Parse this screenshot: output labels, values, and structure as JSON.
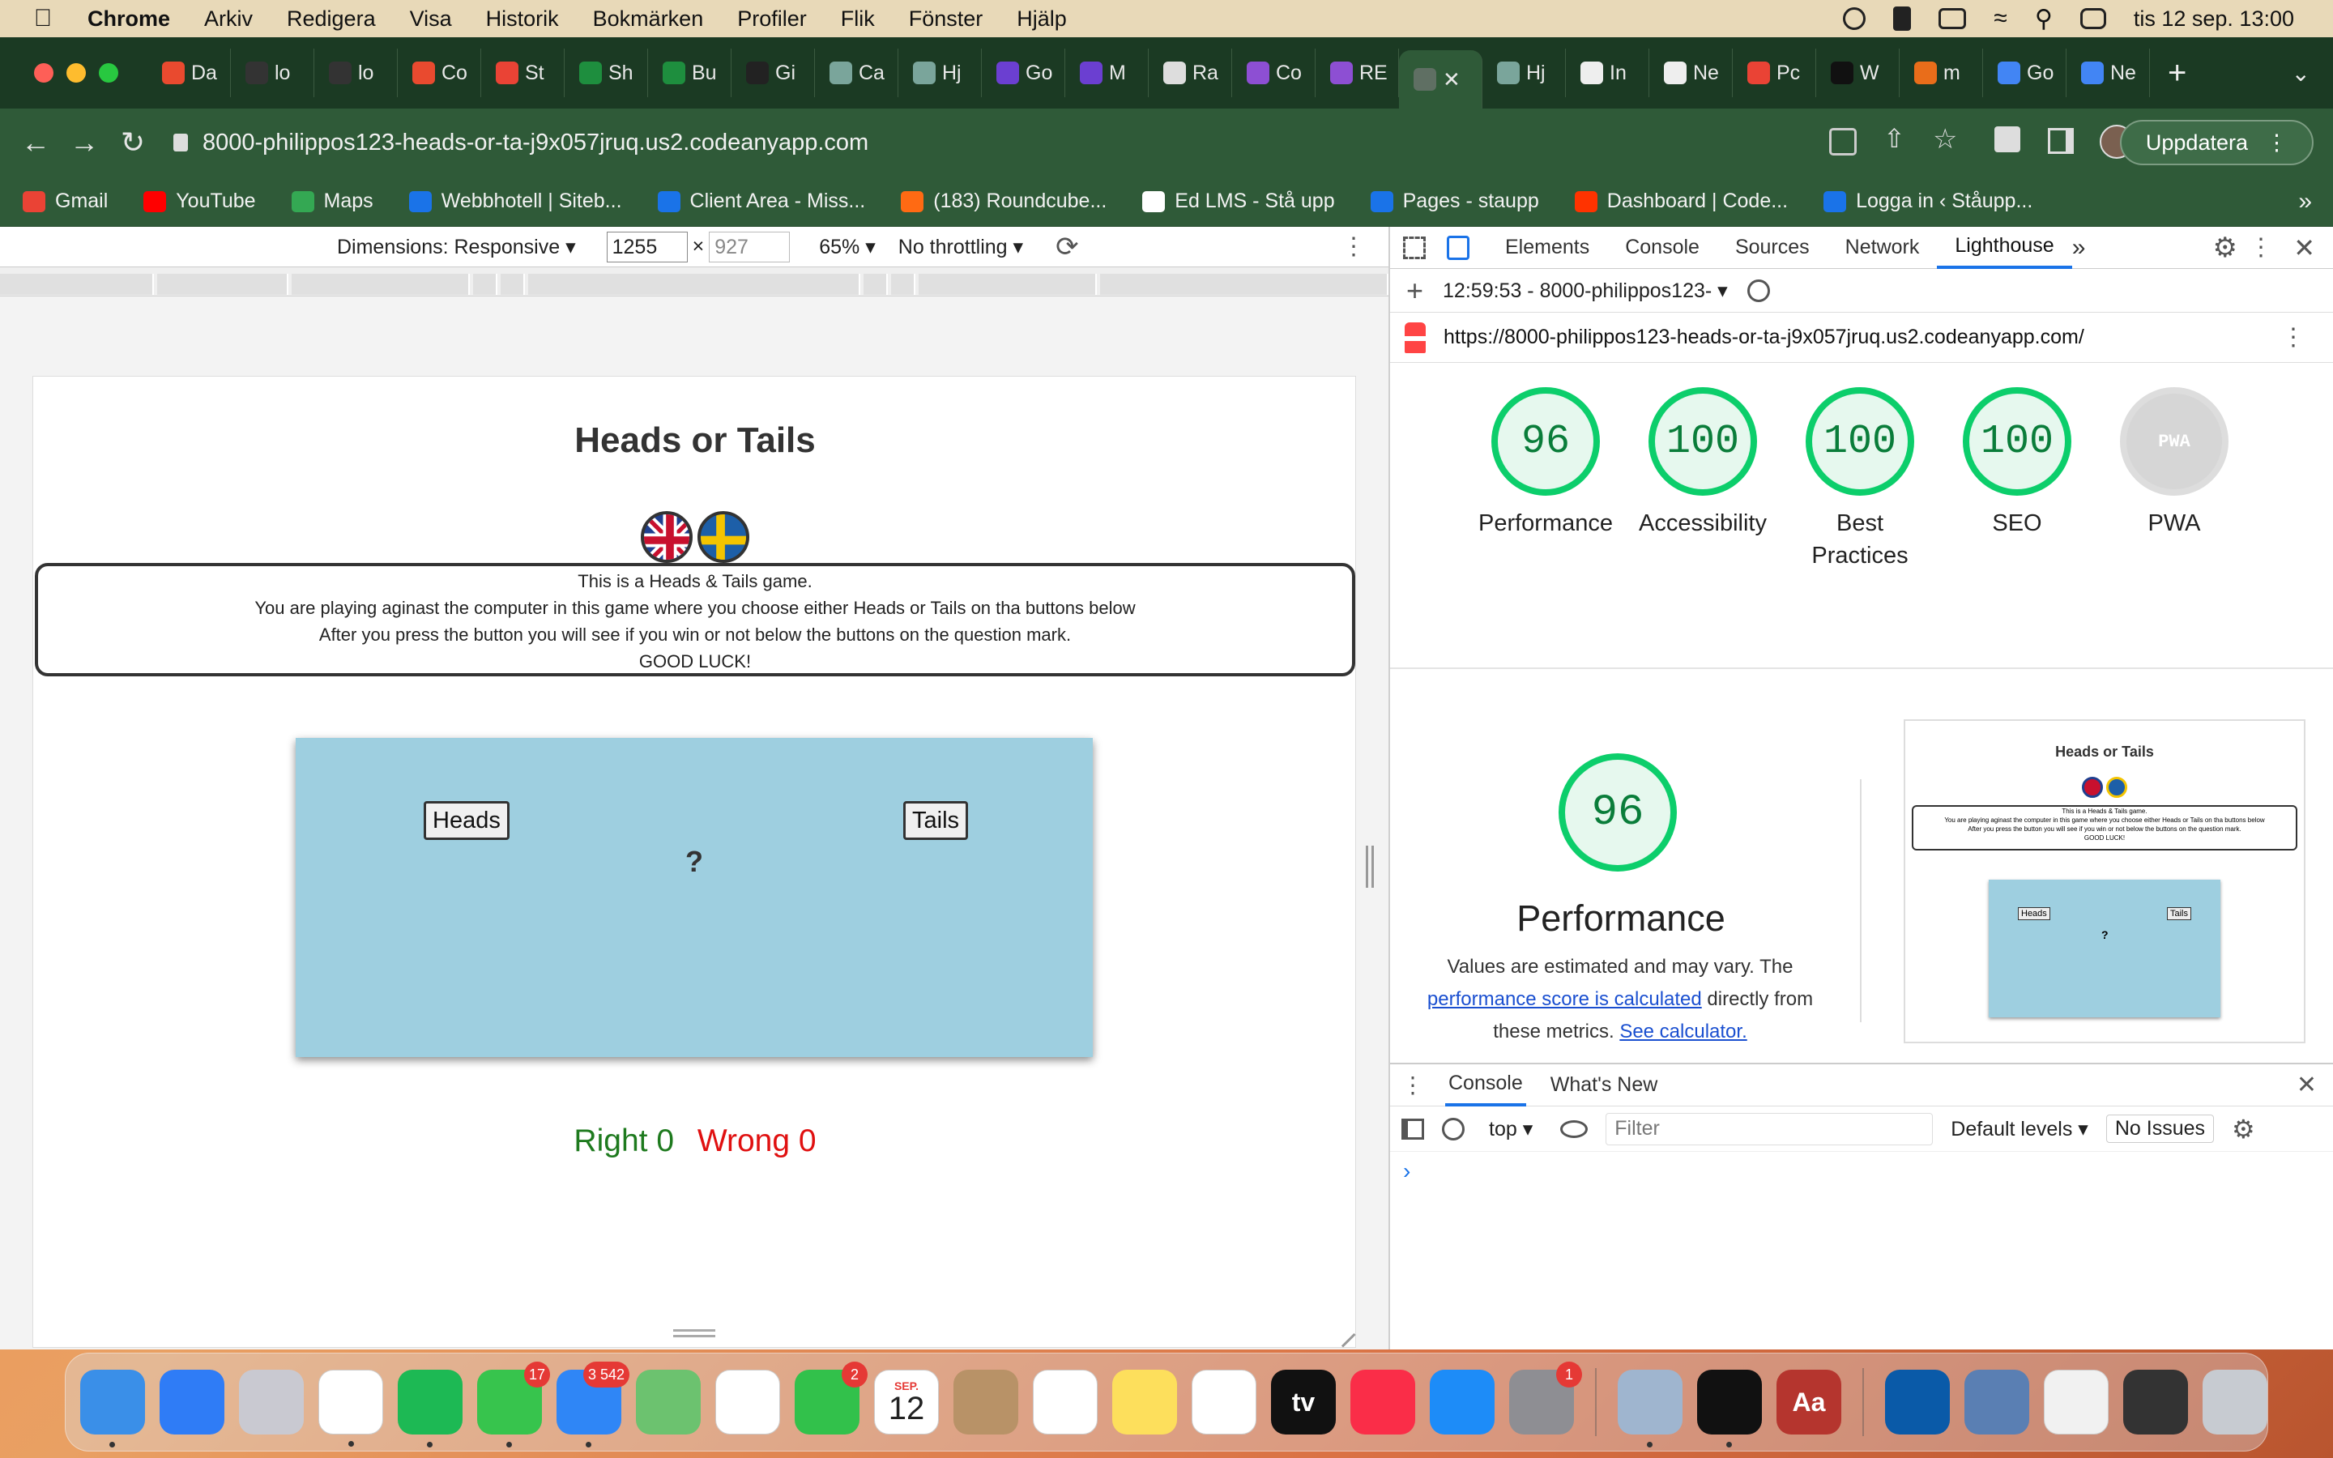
{
  "menubar": {
    "app": "Chrome",
    "items": [
      "Arkiv",
      "Redigera",
      "Visa",
      "Historik",
      "Bokmärken",
      "Profiler",
      "Flik",
      "Fönster",
      "Hjälp"
    ],
    "clock": "tis 12 sep. 13:00"
  },
  "tabs": [
    {
      "label": "Da",
      "color": "#e94a2f"
    },
    {
      "label": "lo",
      "color": "#333333"
    },
    {
      "label": "lo",
      "color": "#333333"
    },
    {
      "label": "Co",
      "color": "#e94a2f"
    },
    {
      "label": "St",
      "color": "#ea4335"
    },
    {
      "label": "Sh",
      "color": "#1e8e3e"
    },
    {
      "label": "Bu",
      "color": "#1e8e3e"
    },
    {
      "label": "Gi",
      "color": "#222222"
    },
    {
      "label": "Ca",
      "color": "#7aa59b"
    },
    {
      "label": "Hj",
      "color": "#7aa59b"
    },
    {
      "label": "Go",
      "color": "#6b3fd1"
    },
    {
      "label": "M",
      "color": "#6b3fd1"
    },
    {
      "label": "Ra",
      "color": "#dddddd"
    },
    {
      "label": "Co",
      "color": "#8d4fd3"
    },
    {
      "label": "RE",
      "color": "#8d4fd3"
    },
    {
      "label": "",
      "color": "#5f6f63",
      "active": true
    },
    {
      "label": "Hj",
      "color": "#7aa59b"
    },
    {
      "label": "In",
      "color": "#eeeeee"
    },
    {
      "label": "Ne",
      "color": "#eeeeee"
    },
    {
      "label": "Pc",
      "color": "#ea4335"
    },
    {
      "label": "W",
      "color": "#111111"
    },
    {
      "label": "m",
      "color": "#e96d1a"
    },
    {
      "label": "Go",
      "color": "#4285f4"
    },
    {
      "label": "Ne",
      "color": "#4285f4"
    }
  ],
  "address": "8000-philippos123-heads-or-ta-j9x057jruq.us2.codeanyapp.com",
  "update_label": "Uppdatera",
  "bookmarks": [
    {
      "label": "Gmail",
      "color": "#ea4335"
    },
    {
      "label": "YouTube",
      "color": "#ff0000"
    },
    {
      "label": "Maps",
      "color": "#34a853"
    },
    {
      "label": "Webbhotell | Siteb...",
      "color": "#1a73e8"
    },
    {
      "label": "Client Area - Miss...",
      "color": "#1a73e8"
    },
    {
      "label": "(183) Roundcube...",
      "color": "#ff6a13"
    },
    {
      "label": "Ed LMS - Stå upp",
      "color": "#ffffff"
    },
    {
      "label": "Pages - staupp",
      "color": "#1a73e8"
    },
    {
      "label": "Dashboard | Code...",
      "color": "#ff3300"
    },
    {
      "label": "Logga in ‹ Ståupp...",
      "color": "#1a73e8"
    }
  ],
  "device_toolbar": {
    "dimensions": "Dimensions: Responsive",
    "width": "1255",
    "height": "927",
    "zoom": "65%",
    "throttling": "No throttling"
  },
  "page": {
    "title": "Heads or Tails",
    "intro_lines": [
      "This is a Heads & Tails game.",
      "You are playing aginast the computer in this game where you choose either Heads or Tails on tha buttons below",
      "After you press the button you will see if you win or not below the buttons on the question mark.",
      "GOOD LUCK!"
    ],
    "heads": "Heads",
    "tails": "Tails",
    "result": "?",
    "right_label": "Right",
    "right_count": 0,
    "wrong_label": "Wrong",
    "wrong_count": 0
  },
  "devtools": {
    "tabs": [
      "Elements",
      "Console",
      "Sources",
      "Network",
      "Lighthouse"
    ],
    "active_tab": "Lighthouse",
    "report_time": "12:59:53 - 8000-philippos123-",
    "report_url": "https://8000-philippos123-heads-or-ta-j9x057jruq.us2.codeanyapp.com/",
    "scores": [
      {
        "label": "Performance",
        "value": 96
      },
      {
        "label": "Accessibility",
        "value": 100
      },
      {
        "label": "Best Practices",
        "value": 100
      },
      {
        "label": "SEO",
        "value": 100
      },
      {
        "label": "PWA",
        "value": null,
        "badge": "PWA"
      }
    ],
    "performance": {
      "score": 96,
      "title": "Performance",
      "text_pre": "Values are estimated and may vary. The",
      "link1": "performance score is calculated",
      "text_mid": "directly from these metrics.",
      "link2": "See calculator."
    },
    "drawer": {
      "tabs": [
        "Console",
        "What's New"
      ],
      "context": "top",
      "filter_placeholder": "Filter",
      "levels": "Default levels",
      "issues": "No Issues"
    }
  },
  "dock": [
    {
      "name": "Finder",
      "color": "#3a8fe8",
      "running": true
    },
    {
      "name": "Safari",
      "color": "#2f7cf6"
    },
    {
      "name": "Launchpad",
      "color": "#c9c9d1"
    },
    {
      "name": "Chrome",
      "color": "#ffffff",
      "running": true
    },
    {
      "name": "Spotify",
      "color": "#1db954",
      "running": true
    },
    {
      "name": "Messages",
      "color": "#37c44d",
      "badge": "17",
      "running": true
    },
    {
      "name": "Mail",
      "color": "#2f86f6",
      "badge": "3 542",
      "running": true
    },
    {
      "name": "Maps",
      "color": "#6cc26f"
    },
    {
      "name": "Photos",
      "color": "#ffffff"
    },
    {
      "name": "FaceTime",
      "color": "#32c14b",
      "badge": "2"
    },
    {
      "name": "Calendar",
      "color": "#ffffff",
      "month": "SEP.",
      "day": "12"
    },
    {
      "name": "Contacts",
      "color": "#b89267"
    },
    {
      "name": "Reminders",
      "color": "#ffffff"
    },
    {
      "name": "Notes",
      "color": "#fddf5c"
    },
    {
      "name": "Freeform",
      "color": "#ffffff"
    },
    {
      "name": "TV",
      "color": "#111111",
      "text": "tv"
    },
    {
      "name": "Music",
      "color": "#fa2d48"
    },
    {
      "name": "App Store",
      "color": "#1d8cf8"
    },
    {
      "name": "System Settings",
      "color": "#8e8e93",
      "badge": "1"
    },
    {
      "name": "Preview",
      "color": "#9fb5cf",
      "running": true
    },
    {
      "name": "Terminal",
      "color": "#111111",
      "running": true
    },
    {
      "name": "Dictionary",
      "color": "#b5352e",
      "text": "Aa"
    },
    {
      "name": "Folder",
      "color": "#0a5aa8"
    },
    {
      "name": "Doc1",
      "color": "#5a7fb3"
    },
    {
      "name": "Doc2",
      "color": "#f1f1f1"
    },
    {
      "name": "Doc3",
      "color": "#333333"
    },
    {
      "name": "Trash",
      "color": "#c7cbd1"
    }
  ]
}
